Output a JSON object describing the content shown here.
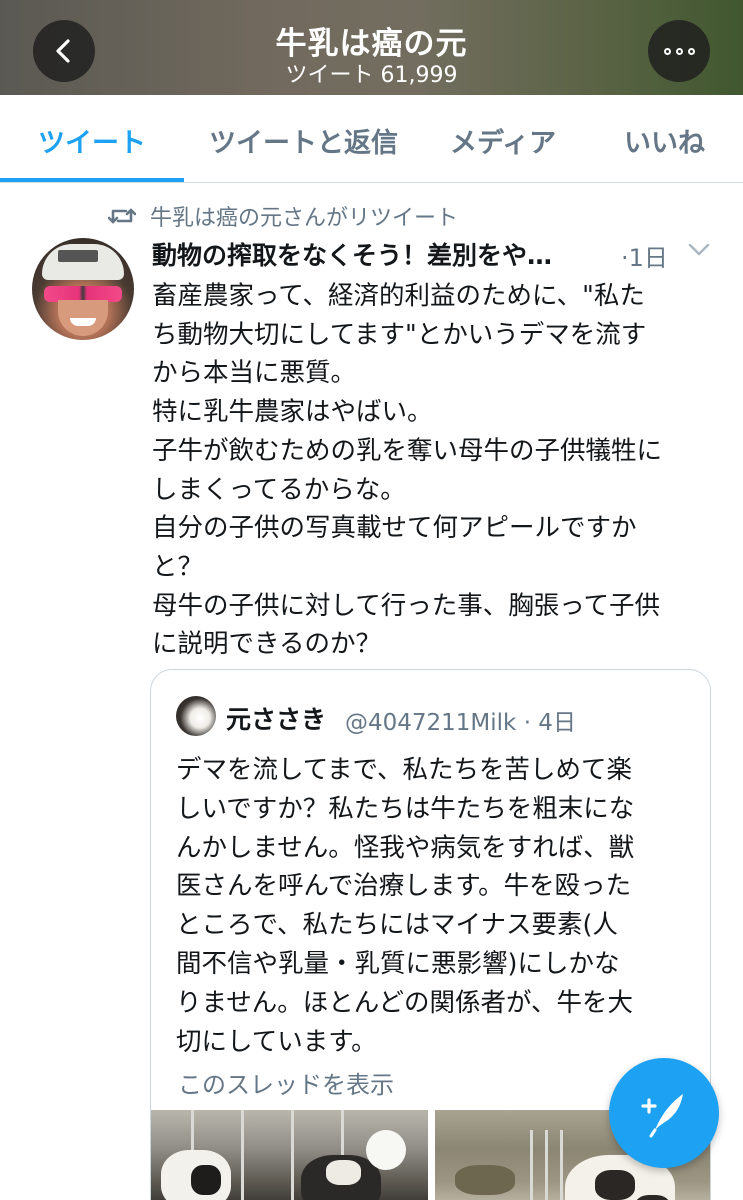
{
  "header": {
    "title": "牛乳は癌の元",
    "subtitle": "ツイート 61,999"
  },
  "tabs": [
    {
      "label": "ツイート",
      "active": true
    },
    {
      "label": "ツイートと返信",
      "active": false
    },
    {
      "label": "メディア",
      "active": false
    },
    {
      "label": "いいね",
      "active": false
    }
  ],
  "retweet_note": "牛乳は癌の元さんがリツイート",
  "tweet": {
    "author_name": "動物の搾取をなくそう！差別をや…",
    "time": "·1日",
    "lines": [
      "畜産農家って、経済的利益のために、\"私た",
      "ち動物大切にしてます\"とかいうデマを流す",
      "から本当に悪質。",
      "特に乳牛農家はやばい。",
      "子牛が飲むための乳を奪い母牛の子供犠牲に",
      "しまくってるからな。",
      "自分の子供の写真載せて何アピールですか",
      "と？",
      "母牛の子供に対して行った事、胸張って子供",
      "に説明できるのか？"
    ]
  },
  "quoted": {
    "name": "元ささき",
    "handle_time": "@4047211Milk · 4日",
    "lines": [
      "デマを流してまで、私たちを苦しめて楽",
      "しいですか？私たちは牛たちを粗末にな",
      "んかしません。怪我や病気をすれば、獣",
      "医さんを呼んで治療します。牛を殴った",
      "ところで、私たちにはマイナス要素(人",
      "間不信や乳量・乳質に悪影響)にしかな",
      "りません。ほとんどの関係者が、牛を大",
      "切にしています。"
    ],
    "thread_link": "このスレッドを表示"
  },
  "icons": {
    "back": "chevron-left-icon",
    "more": "more-horizontal-icon",
    "retweet": "retweet-icon",
    "caret": "chevron-down-icon",
    "compose": "compose-feather-icon"
  },
  "colors": {
    "accent": "#1da1f2",
    "secondary_text": "#657786",
    "primary_text": "#14171a"
  }
}
